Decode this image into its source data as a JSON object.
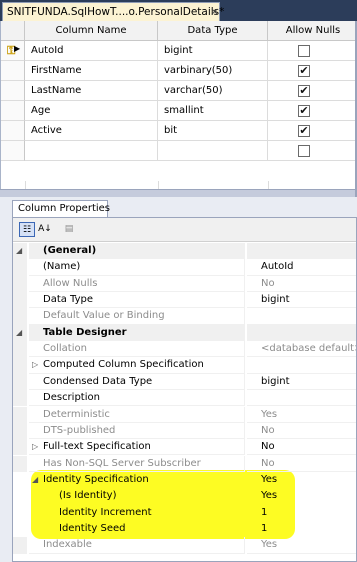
{
  "window": {
    "tab_title": "SNITFUNDA.SqlHowT....o.PersonalDetails*",
    "tab_close": "×"
  },
  "grid": {
    "headers": [
      "Column Name",
      "Data Type",
      "Allow Nulls"
    ],
    "rows": [
      {
        "name": "AutoId",
        "type": "bigint",
        "allow_nulls": false,
        "primary_key": true
      },
      {
        "name": "FirstName",
        "type": "varbinary(50)",
        "allow_nulls": true
      },
      {
        "name": "LastName",
        "type": "varchar(50)",
        "allow_nulls": true
      },
      {
        "name": "Age",
        "type": "smallint",
        "allow_nulls": true
      },
      {
        "name": "Active",
        "type": "bit",
        "allow_nulls": true
      },
      {
        "name": "",
        "type": "",
        "allow_nulls": false
      }
    ],
    "check_glyph": "✔",
    "key_icon": "key-icon"
  },
  "properties": {
    "tab_label": "Column Properties",
    "toolbar": {
      "categorized": "categorized-icon",
      "alphabetical": "alphabetical-icon",
      "property_pages": "property-pages-icon",
      "alphabetical_glyph": "A↓",
      "categorized_glyph": "☷",
      "pages_glyph": "▤"
    },
    "rows": [
      {
        "kind": "cat",
        "name": "(General)",
        "value": "",
        "expander": "◢"
      },
      {
        "kind": "item",
        "name": "(Name)",
        "value": "AutoId"
      },
      {
        "kind": "item",
        "name": "Allow Nulls",
        "value": "No",
        "gray": true
      },
      {
        "kind": "item",
        "name": "Data Type",
        "value": "bigint"
      },
      {
        "kind": "item",
        "name": "Default Value or Binding",
        "value": "",
        "gray": true
      },
      {
        "kind": "cat",
        "name": "Table Designer",
        "value": "",
        "expander": "◢"
      },
      {
        "kind": "item",
        "name": "Collation",
        "value": "<database default>",
        "gray": true
      },
      {
        "kind": "item",
        "name": "Computed Column Specification",
        "value": "",
        "expander": "▷"
      },
      {
        "kind": "item",
        "name": "Condensed Data Type",
        "value": "bigint"
      },
      {
        "kind": "item",
        "name": "Description",
        "value": ""
      },
      {
        "kind": "item",
        "name": "Deterministic",
        "value": "Yes",
        "gray": true
      },
      {
        "kind": "item",
        "name": "DTS-published",
        "value": "No",
        "gray": true
      },
      {
        "kind": "item",
        "name": "Full-text Specification",
        "value": "No",
        "expander": "▷"
      },
      {
        "kind": "item",
        "name": "Has Non-SQL Server Subscriber",
        "value": "No",
        "gray": true
      },
      {
        "kind": "item",
        "name": "Identity Specification",
        "value": "Yes",
        "expander": "◢"
      },
      {
        "kind": "sub",
        "name": "(Is Identity)",
        "value": "Yes"
      },
      {
        "kind": "sub",
        "name": "Identity Increment",
        "value": "1"
      },
      {
        "kind": "sub",
        "name": "Identity Seed",
        "value": "1"
      },
      {
        "kind": "item",
        "name": "Indexable",
        "value": "Yes",
        "gray": true
      }
    ]
  },
  "colors": {
    "highlight": "#fdfc17",
    "tab_bg": "#fcf3d3",
    "chrome": "#2c3d5a"
  }
}
